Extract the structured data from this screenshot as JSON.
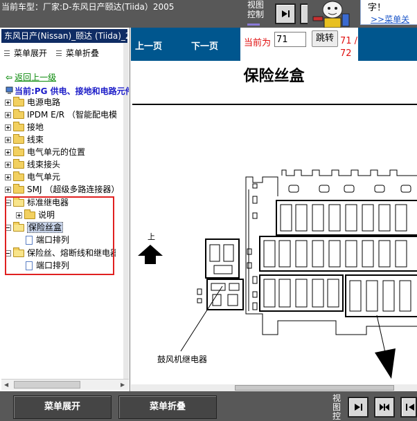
{
  "header": {
    "title": "当前车型：厂家:D-东风日产颐达(Tiida）2005",
    "view_control": "视图控制",
    "tip_text": "字！",
    "tip_link": ">>菜单关"
  },
  "sidebar": {
    "title": "东风日产(Nissan)_颐达 (Tiida)_2",
    "expand_label": "菜单展开",
    "collapse_label": "菜单折叠",
    "back_label": "返回上一级",
    "current_label": "当前:PG 供电、接地和电路元件",
    "tree": [
      {
        "label": "电源电路"
      },
      {
        "label": "IPDM E/R （智能配电模"
      },
      {
        "label": "接地"
      },
      {
        "label": "线束"
      },
      {
        "label": "电气单元的位置"
      },
      {
        "label": "线束接头"
      },
      {
        "label": "电气单元"
      },
      {
        "label": "SMJ （超级多路连接器）"
      },
      {
        "label": "标准继电器"
      },
      {
        "label": "说明"
      },
      {
        "label": "保险丝盒"
      },
      {
        "label": "端口排列"
      },
      {
        "label": "保险丝、熔断线和继电器"
      },
      {
        "label": "端口排列"
      }
    ]
  },
  "toolbar": {
    "prev_label": "上一页",
    "next_label": "下一页",
    "current_prefix": "当前为",
    "page_value": "71",
    "go_label": "跳转",
    "total": "71 / 72"
  },
  "document": {
    "title": "保险丝盒",
    "up_label": "上",
    "relay_label": "鼓风机继电器"
  },
  "footer": {
    "expand_label": "菜单展开",
    "collapse_label": "菜单折叠",
    "view_control": "视图控"
  },
  "colors": {
    "header_bg": "#585858",
    "nav_bg": "#00568e",
    "sidebar_title_bg": "#0f2c64",
    "highlight_box": "#e02020"
  }
}
